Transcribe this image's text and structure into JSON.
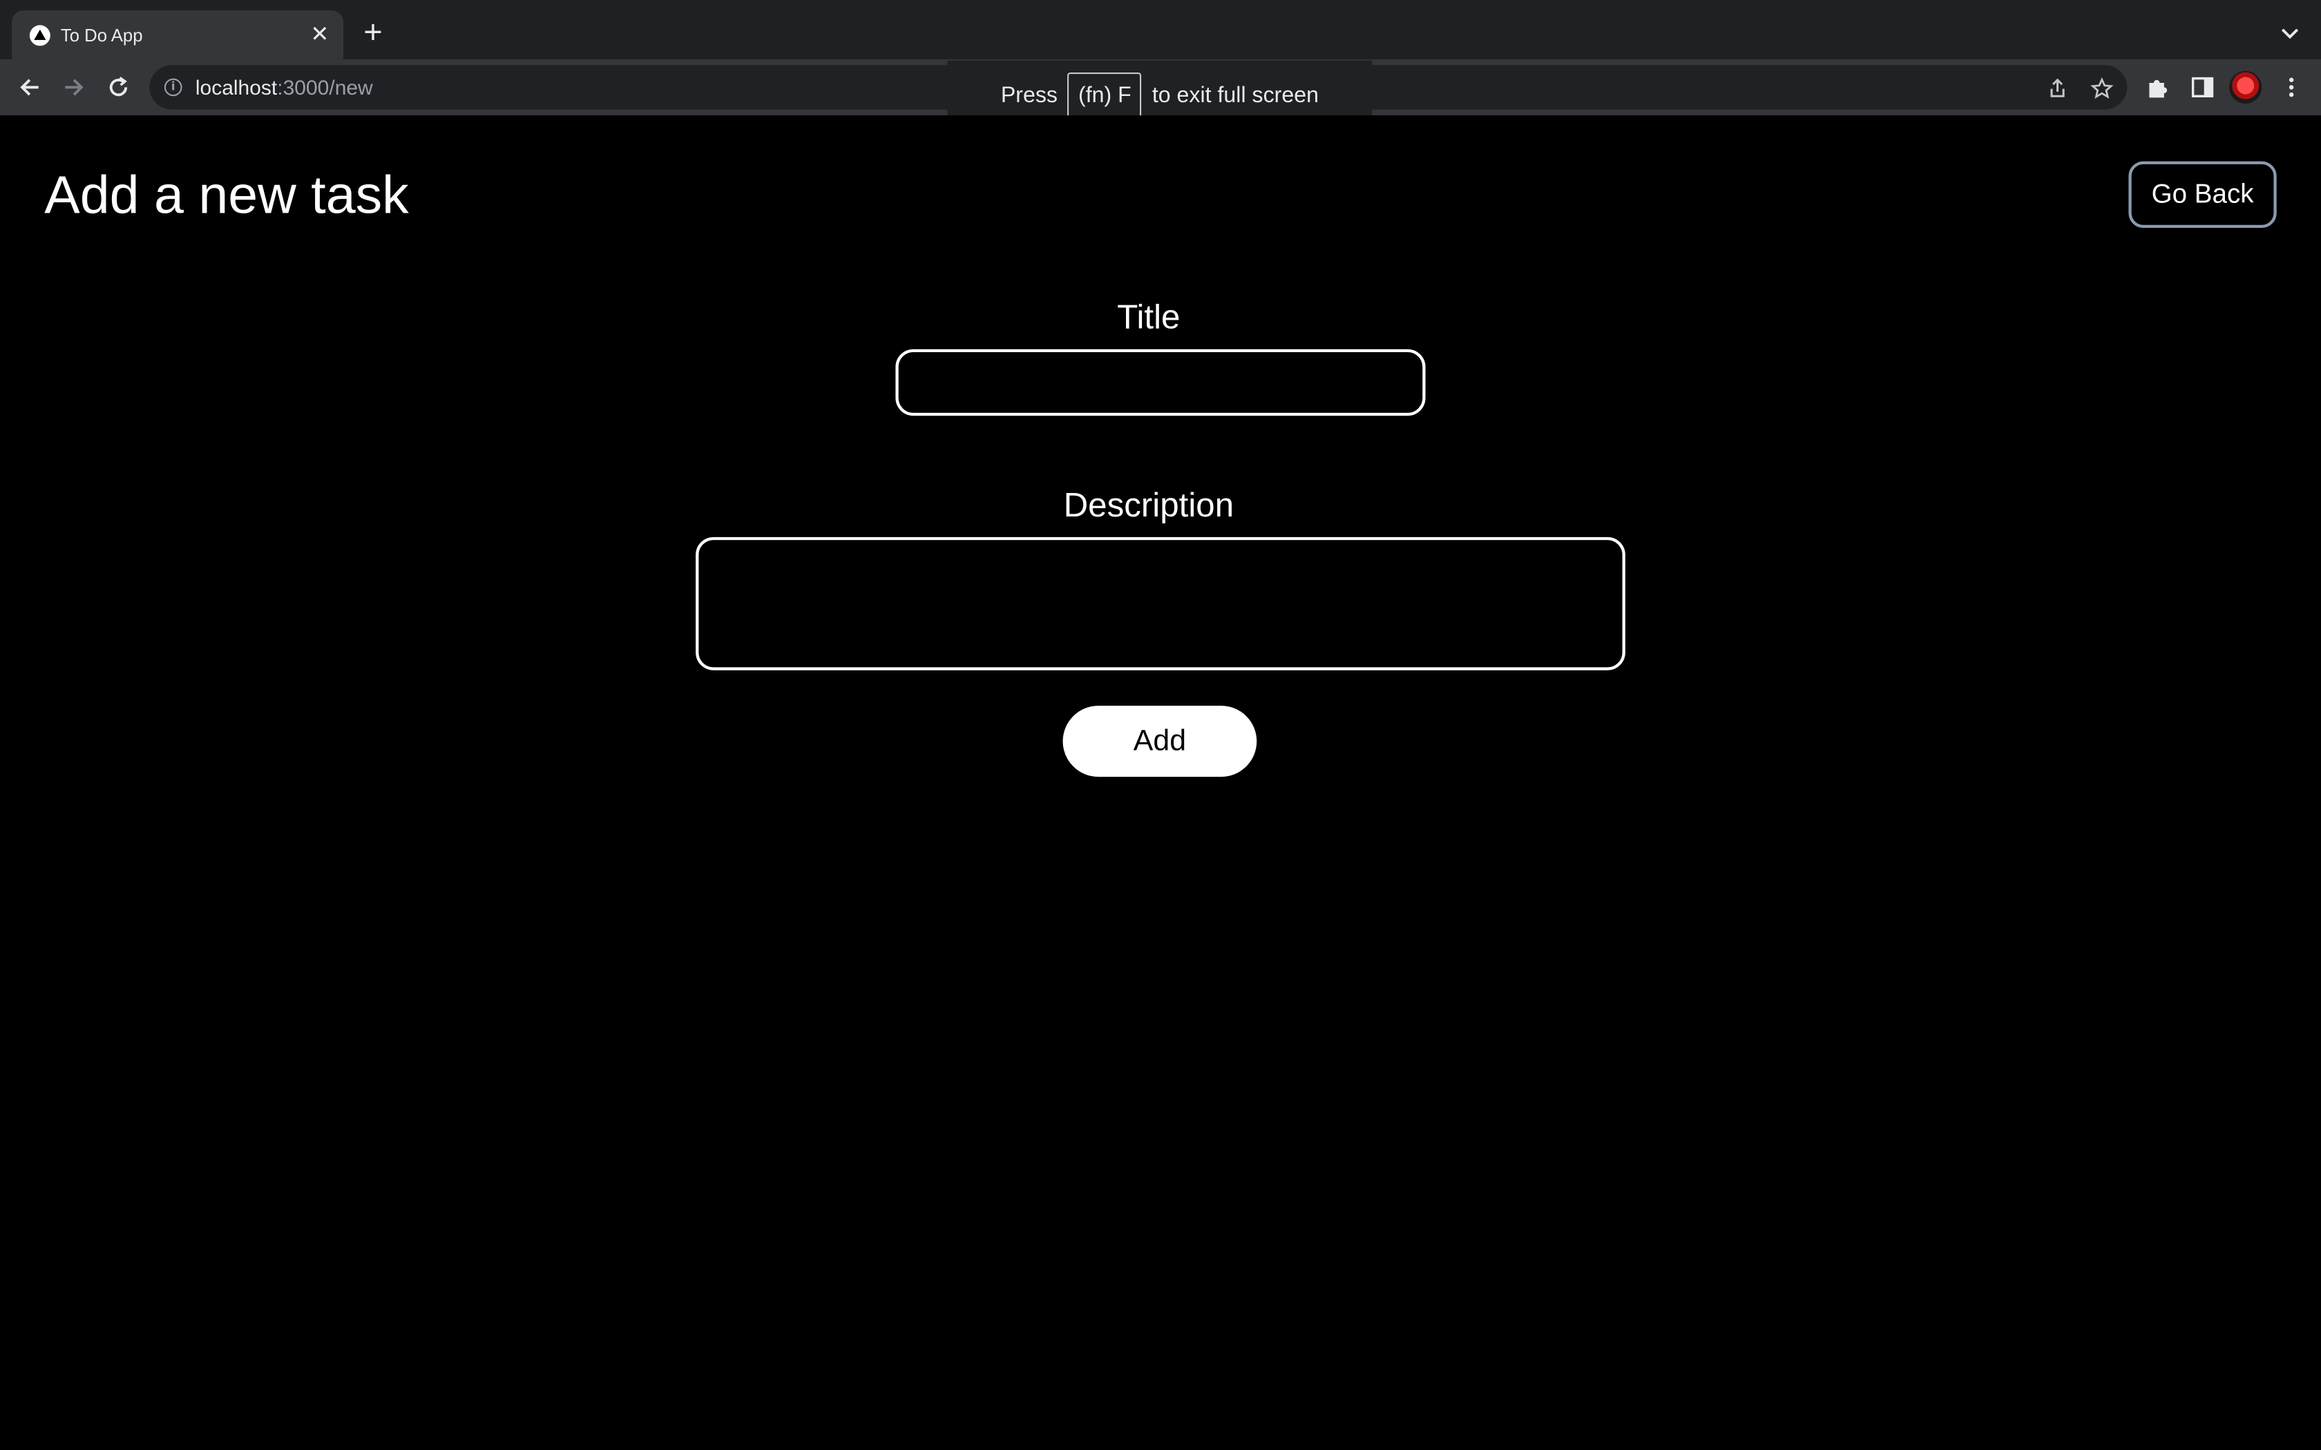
{
  "browser": {
    "tab_title": "To Do App",
    "url_host": "localhost",
    "url_rest": ":3000/new",
    "fullscreen_press": "Press",
    "fullscreen_key": "(fn) F",
    "fullscreen_rest": "to exit full screen"
  },
  "page": {
    "title": "Add a new task",
    "go_back_label": "Go Back"
  },
  "form": {
    "title_label": "Title",
    "title_value": "",
    "description_label": "Description",
    "description_value": "",
    "add_label": "Add"
  },
  "colors": {
    "background": "#000000",
    "text": "#ffffff",
    "go_back_border": "#8a9bb0",
    "add_button_bg": "#ffffff"
  }
}
